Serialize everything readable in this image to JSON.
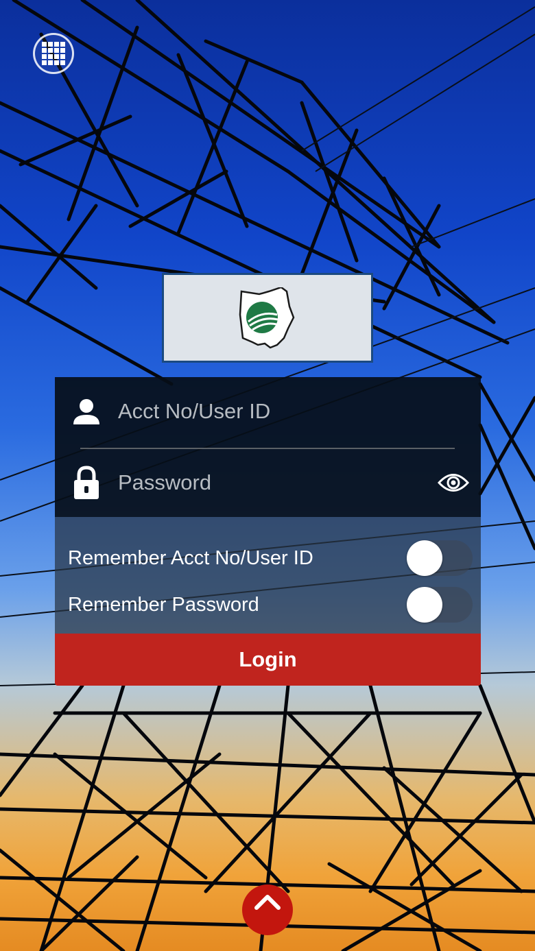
{
  "login_form": {
    "user_field": {
      "placeholder": "Acct No/User ID",
      "value": ""
    },
    "password_field": {
      "placeholder": "Password",
      "value": ""
    },
    "remember_user": {
      "label": "Remember Acct No/User ID",
      "enabled": false
    },
    "remember_password": {
      "label": "Remember Password",
      "enabled": false
    },
    "login_label": "Login"
  },
  "icons": {
    "apps": "grid-icon",
    "user": "user-icon",
    "lock": "lock-icon",
    "eye": "eye-icon",
    "expand": "chevron-up-icon",
    "logo": "ohio-cooperative-logo"
  },
  "colors": {
    "login_button": "#c0241e",
    "expand_button": "#c3160e",
    "logo_border": "#1b4a80",
    "logo_green": "#1f7a45"
  }
}
